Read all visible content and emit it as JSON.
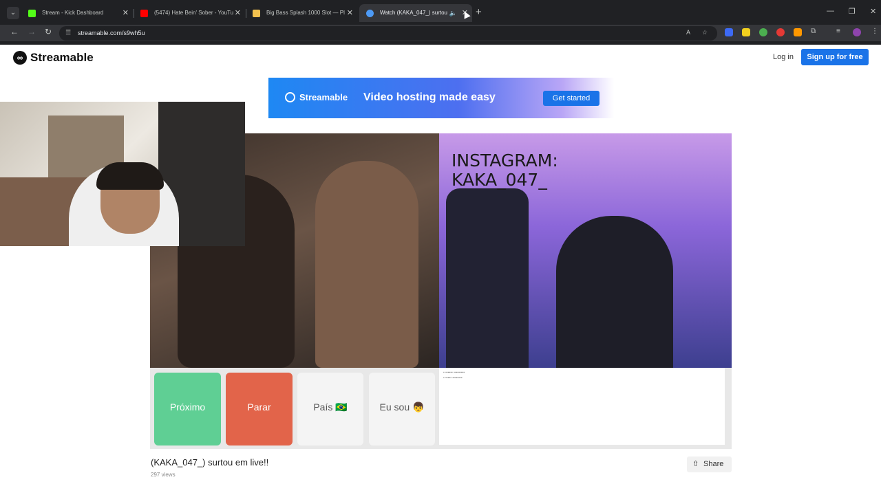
{
  "tabs": [
    {
      "title": "Stream - Kick Dashboard",
      "favicon_color": "#53fc18"
    },
    {
      "title": "(5474) Hate Bein' Sober - YouTu",
      "favicon_color": "#ff0000"
    },
    {
      "title": "Big Bass Splash 1000 Slot — Pl",
      "favicon_color": "#f2c14e"
    },
    {
      "title": "Watch (KAKA_047_) surtou",
      "favicon_color": "#4d9af5"
    }
  ],
  "url": "streamable.com/s9wh5u",
  "site": {
    "logo_text": "Streamable",
    "login": "Log in",
    "signup": "Sign up for free"
  },
  "banner": {
    "brand": "Streamable",
    "tagline": "Video hosting made easy",
    "cta": "Get started"
  },
  "video_overlay": {
    "insta_line1": "INSTAGRAM:",
    "insta_line2": "KAKA_047_"
  },
  "controls": {
    "next": "Próximo",
    "stop": "Parar",
    "country": "País 🇧🇷",
    "iam": "Eu sou 👦"
  },
  "video_info": {
    "title": "(KAKA_047_) surtou em live!!",
    "views": "297 views",
    "share": "Share"
  },
  "colors": {
    "accent": "#1a73e8",
    "next_green": "#5fcf94",
    "stop_orange": "#e2644a"
  }
}
